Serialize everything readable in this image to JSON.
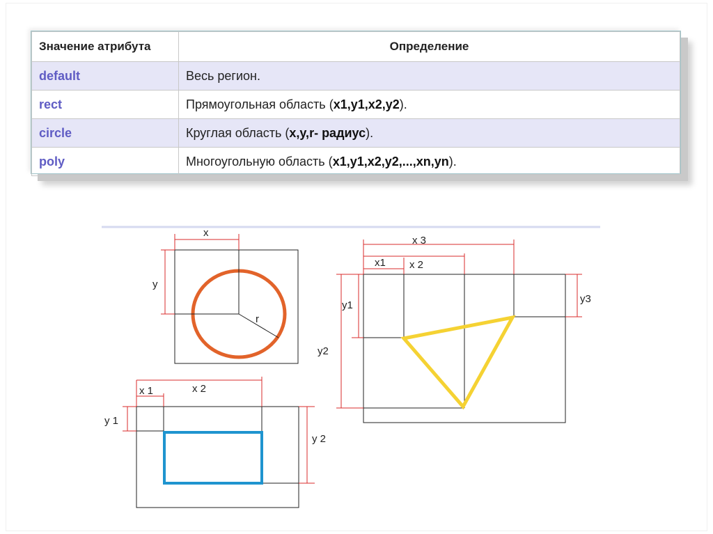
{
  "table": {
    "header_attr": "Значение атрибута",
    "header_def": "Определение",
    "rows": [
      {
        "key": "default",
        "parts": [
          {
            "t": "Весь регион.",
            "b": false
          }
        ]
      },
      {
        "key": "rect",
        "parts": [
          {
            "t": "Прямоугольная область (",
            "b": false
          },
          {
            "t": "x1,y1,x2,y2",
            "b": true
          },
          {
            "t": ").",
            "b": false
          }
        ]
      },
      {
        "key": "circle",
        "parts": [
          {
            "t": "Круглая область (",
            "b": false
          },
          {
            "t": "x,y,r- радиус",
            "b": true
          },
          {
            "t": ").",
            "b": false
          }
        ]
      },
      {
        "key": "poly",
        "parts": [
          {
            "t": "Многоугольную область (",
            "b": false
          },
          {
            "t": "x1,y1,x2,y2,...,xn,yn",
            "b": true
          },
          {
            "t": ").",
            "b": false
          }
        ]
      }
    ]
  },
  "diagram": {
    "circle_fig": {
      "x": "x",
      "y": "y",
      "r": "r"
    },
    "rect_fig": {
      "x1": "x 1",
      "x2": "x 2",
      "y1": "y 1",
      "y2": "y 2"
    },
    "poly_fig": {
      "x1": "x1",
      "x2": "x 2",
      "x3": "x 3",
      "y1": "y1",
      "y2": "y2",
      "y3": "y3"
    },
    "colors": {
      "circle": "#e2632a",
      "rect": "#1f94cf",
      "triangle": "#f5d233",
      "dimension": "#d92b2b"
    }
  }
}
